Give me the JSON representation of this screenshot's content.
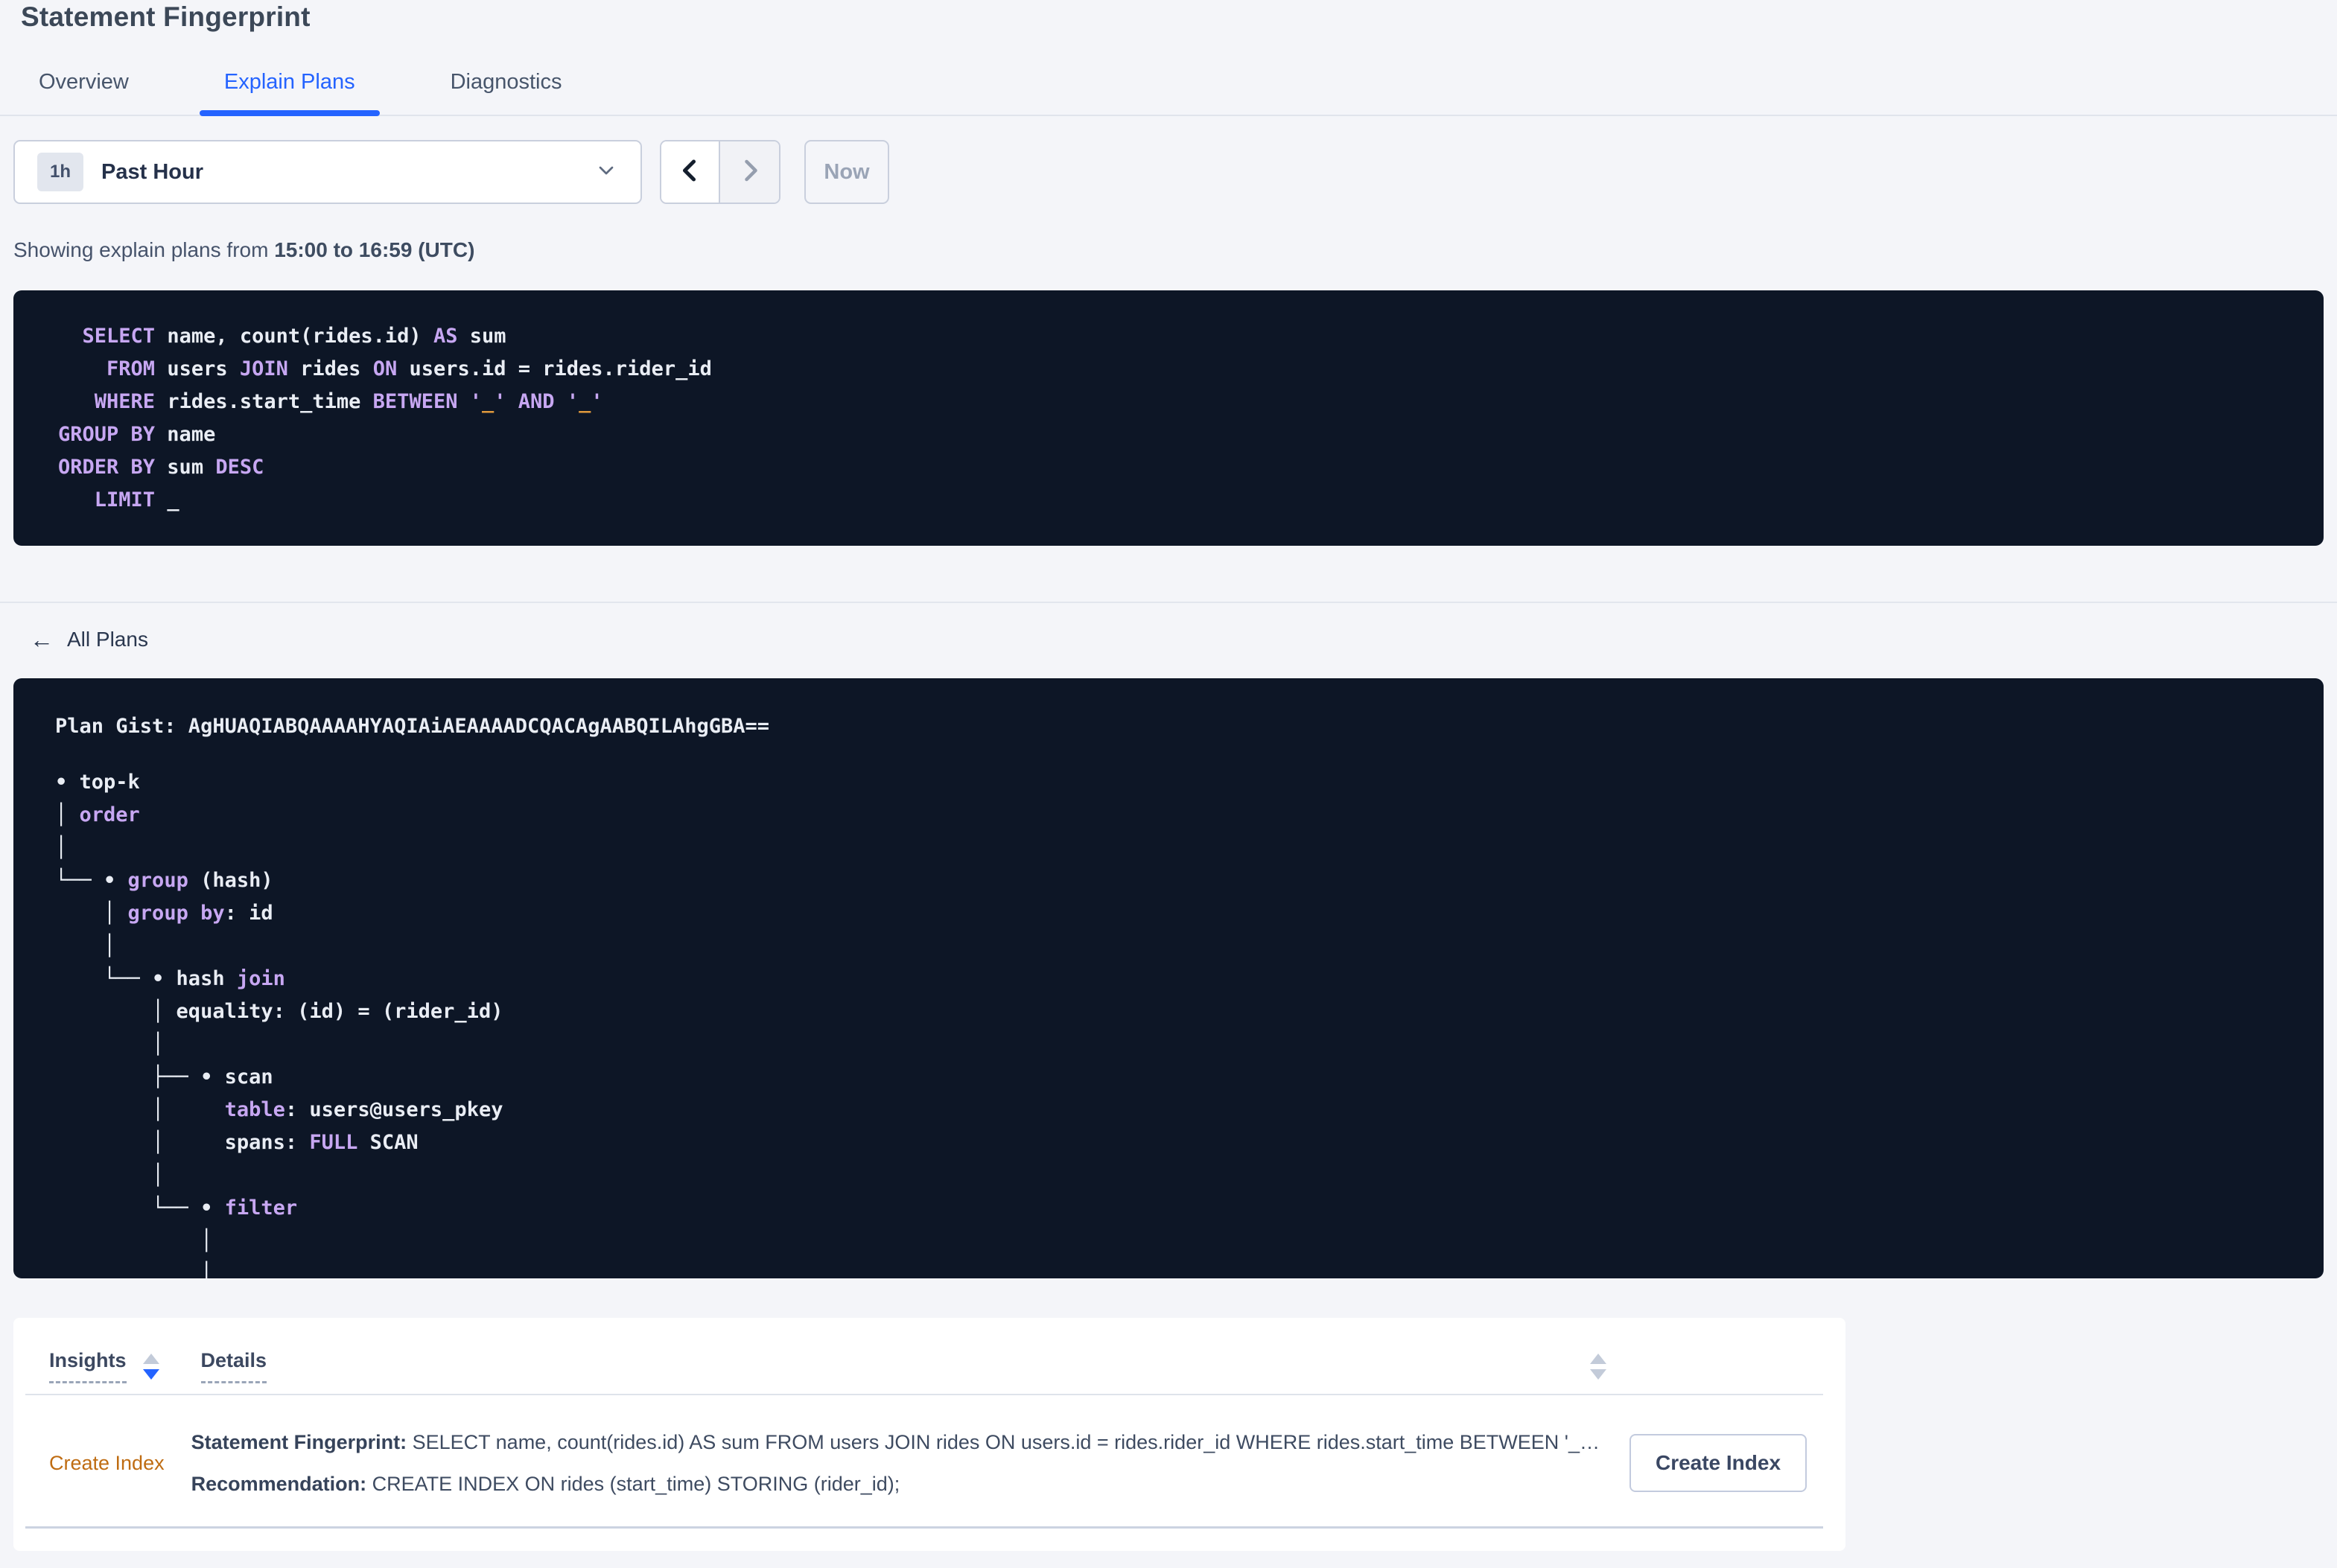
{
  "page": {
    "title": "Statement Fingerprint"
  },
  "tabs": [
    {
      "label": "Overview"
    },
    {
      "label": "Explain Plans"
    },
    {
      "label": "Diagnostics"
    }
  ],
  "time_selector": {
    "badge": "1h",
    "label": "Past Hour",
    "now_label": "Now"
  },
  "subtitle": {
    "prefix": "Showing explain plans from ",
    "range": "15:00 to 16:59 (UTC)"
  },
  "sql_block": {
    "lines": [
      [
        [
          "t",
          "  "
        ],
        [
          "k",
          "SELECT"
        ],
        [
          "t",
          " name, count(rides.id) "
        ],
        [
          "k",
          "AS"
        ],
        [
          "t",
          " sum"
        ]
      ],
      [
        [
          "t",
          "    "
        ],
        [
          "k",
          "FROM"
        ],
        [
          "t",
          " users "
        ],
        [
          "k",
          "JOIN"
        ],
        [
          "t",
          " rides "
        ],
        [
          "k",
          "ON"
        ],
        [
          "t",
          " users.id = rides.rider_id"
        ]
      ],
      [
        [
          "t",
          "   "
        ],
        [
          "k",
          "WHERE"
        ],
        [
          "t",
          " rides.start_time "
        ],
        [
          "k",
          "BETWEEN"
        ],
        [
          "t",
          " "
        ],
        [
          "k",
          "'"
        ],
        [
          "o",
          "_"
        ],
        [
          "k",
          "'"
        ],
        [
          "t",
          " "
        ],
        [
          "k",
          "AND"
        ],
        [
          "t",
          " "
        ],
        [
          "k",
          "'"
        ],
        [
          "o",
          "_"
        ],
        [
          "k",
          "'"
        ]
      ],
      [
        [
          "k",
          "GROUP BY"
        ],
        [
          "t",
          " name"
        ]
      ],
      [
        [
          "k",
          "ORDER BY"
        ],
        [
          "t",
          " sum "
        ],
        [
          "k",
          "DESC"
        ]
      ],
      [
        [
          "t",
          "   "
        ],
        [
          "k",
          "LIMIT"
        ],
        [
          "t",
          " _"
        ]
      ]
    ]
  },
  "back_link": {
    "arrow": "←",
    "label": "All Plans"
  },
  "plan": {
    "gist": "Plan Gist: AgHUAQIABQAAAAHYAQIAiAEAAAADCQACAgAABQILAhgGBA==",
    "tree_lines": [
      [
        [
          "t",
          "• top-k"
        ]
      ],
      [
        [
          "t",
          "│ "
        ],
        [
          "k",
          "order"
        ]
      ],
      [
        [
          "t",
          "│"
        ]
      ],
      [
        [
          "t",
          "└── • "
        ],
        [
          "k",
          "group"
        ],
        [
          "t",
          " (hash)"
        ]
      ],
      [
        [
          "t",
          "    │ "
        ],
        [
          "k",
          "group by"
        ],
        [
          "t",
          ": id"
        ]
      ],
      [
        [
          "t",
          "    │"
        ]
      ],
      [
        [
          "t",
          "    └── • hash "
        ],
        [
          "k",
          "join"
        ]
      ],
      [
        [
          "t",
          "        │ equality: (id) = (rider_id)"
        ]
      ],
      [
        [
          "t",
          "        │"
        ]
      ],
      [
        [
          "t",
          "        ├── • scan"
        ]
      ],
      [
        [
          "t",
          "        │     "
        ],
        [
          "k",
          "table"
        ],
        [
          "t",
          ": users@users_pkey"
        ]
      ],
      [
        [
          "t",
          "        │     spans: "
        ],
        [
          "k",
          "FULL"
        ],
        [
          "t",
          " SCAN"
        ]
      ],
      [
        [
          "t",
          "        │"
        ]
      ],
      [
        [
          "t",
          "        └── • "
        ],
        [
          "k",
          "filter"
        ]
      ],
      [
        [
          "t",
          "            │"
        ]
      ],
      [
        [
          "t",
          "            │"
        ]
      ]
    ]
  },
  "insights_table": {
    "columns": [
      "Insights",
      "Details"
    ],
    "row": {
      "insight": "Create Index",
      "detail_lines": [
        {
          "label": "Statement Fingerprint:",
          "text": " SELECT name, count(rides.id) AS sum FROM users JOIN rides ON users.id = rides.rider_id WHERE rides.start_time BETWEEN '_…"
        },
        {
          "label": "Recommendation:",
          "text": " CREATE INDEX ON rides (start_time) STORING (rider_id);"
        }
      ],
      "action_label": "Create Index"
    }
  },
  "colors": {
    "accent_blue": "#2463ff",
    "panel_bg": "#0d1626",
    "code_keyword": "#c7a7f2",
    "code_plain": "#e9edf4",
    "code_literal": "#e0993c",
    "insight_orange": "#bf6c12",
    "page_bg": "#f4f5f9"
  }
}
